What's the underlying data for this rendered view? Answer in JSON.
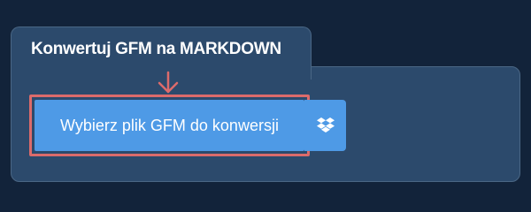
{
  "converter": {
    "tab_title": "Konwertuj GFM na MARKDOWN",
    "upload_label": "Wybierz plik GFM do konwersji",
    "dropbox_icon": "dropbox-icon",
    "pointer_icon": "arrow-down-icon"
  },
  "colors": {
    "background": "#12233a",
    "panel": "#2c4a6c",
    "button": "#4e9ae6",
    "highlight": "#dc6b6b"
  }
}
